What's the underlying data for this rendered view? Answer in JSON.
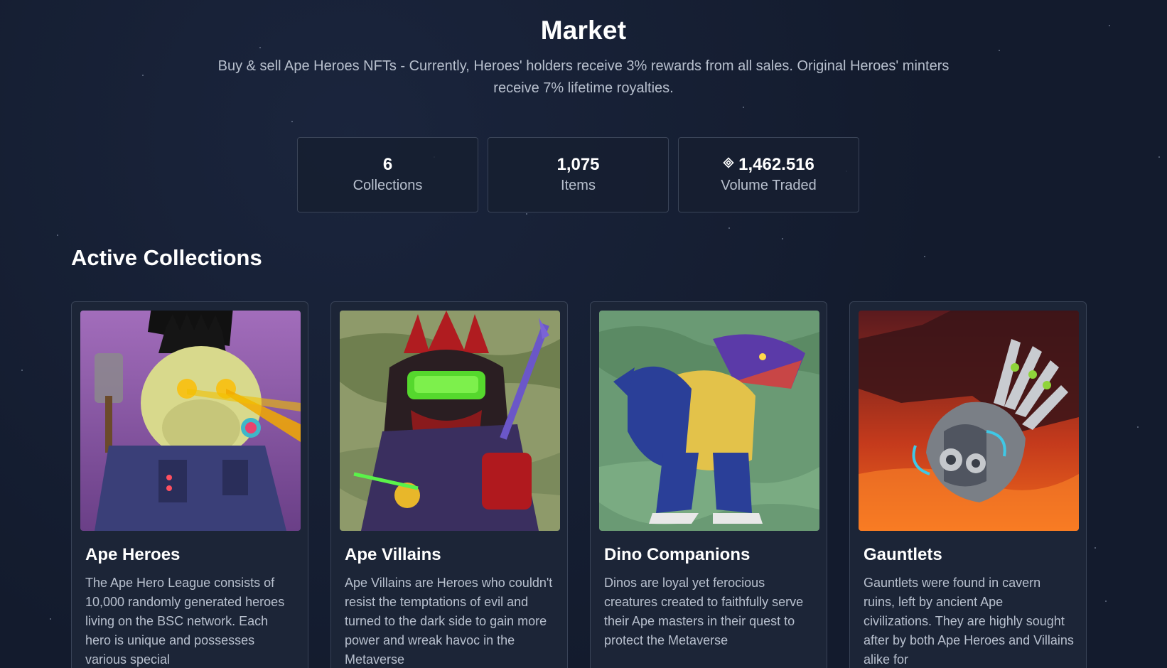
{
  "header": {
    "title": "Market",
    "subtitle": "Buy & sell Ape Heroes NFTs - Currently, Heroes' holders receive 3% rewards from all sales. Original Heroes' minters receive 7% lifetime royalties."
  },
  "stats": [
    {
      "value": "6",
      "label": "Collections"
    },
    {
      "value": "1,075",
      "label": "Items"
    },
    {
      "value": "1,462.516",
      "label": "Volume Traded",
      "icon": "bnb-icon"
    }
  ],
  "section": {
    "title": "Active Collections"
  },
  "collections": [
    {
      "name": "Ape Heroes",
      "description": "The Ape Hero League consists of 10,000 randomly generated heroes living on the BSC network. Each hero is unique and possesses various special"
    },
    {
      "name": "Ape Villains",
      "description": "Ape Villains are Heroes who couldn't resist the temptations of evil and turned to the dark side to gain more power and wreak havoc in the Metaverse"
    },
    {
      "name": "Dino Companions",
      "description": "Dinos are loyal yet ferocious creatures created to faithfully serve their Ape masters in their quest to protect the Metaverse"
    },
    {
      "name": "Gauntlets",
      "description": "Gauntlets were found in cavern ruins, left by ancient Ape civilizations. They are highly sought after by both Ape Heroes and Villains alike for"
    }
  ],
  "colors": {
    "background": "#131b2d",
    "card": "#1c2537",
    "border": "#394357",
    "muted_text": "#b8c0ce"
  }
}
